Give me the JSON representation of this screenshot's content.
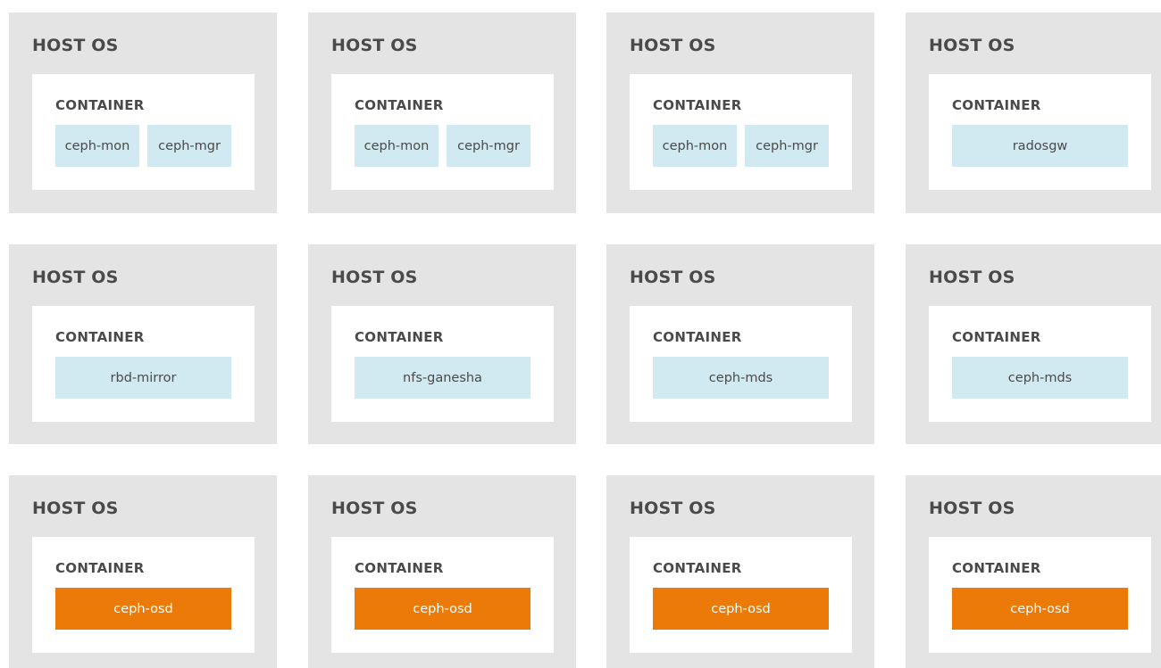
{
  "host_label": "HOST OS",
  "container_label": "CONTAINER",
  "colors": {
    "host_bg": "#e4e4e4",
    "container_bg": "#ffffff",
    "service_default": "#d1e9f0",
    "service_osd": "#ec7a08"
  },
  "rows": [
    {
      "hosts": [
        {
          "services": [
            "ceph-mon",
            "ceph-mgr"
          ]
        },
        {
          "services": [
            "ceph-mon",
            "ceph-mgr"
          ]
        },
        {
          "services": [
            "ceph-mon",
            "ceph-mgr"
          ]
        },
        {
          "services": [
            "radosgw"
          ]
        }
      ]
    },
    {
      "hosts": [
        {
          "services": [
            "rbd-mirror"
          ]
        },
        {
          "services": [
            "nfs-ganesha"
          ]
        },
        {
          "services": [
            "ceph-mds"
          ]
        },
        {
          "services": [
            "ceph-mds"
          ]
        }
      ]
    },
    {
      "hosts": [
        {
          "services": [
            "ceph-osd"
          ]
        },
        {
          "services": [
            "ceph-osd"
          ]
        },
        {
          "services": [
            "ceph-osd"
          ]
        },
        {
          "services": [
            "ceph-osd"
          ]
        }
      ]
    }
  ]
}
